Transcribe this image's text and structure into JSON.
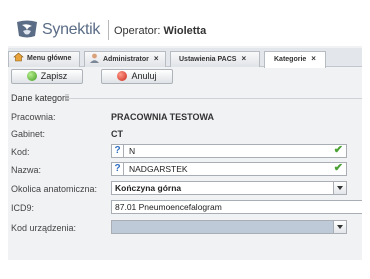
{
  "header": {
    "brand": "Synektik",
    "operator_label": "Operator:",
    "operator_name": "Wioletta"
  },
  "tabs": [
    {
      "label": "Menu główne",
      "icon": "home-icon",
      "closable": false
    },
    {
      "label": "Administrator",
      "icon": "user-icon",
      "closable": true
    },
    {
      "label": "Ustawienia PACS",
      "icon": "",
      "closable": true
    },
    {
      "label": "Kategorie",
      "icon": "",
      "closable": true,
      "active": true
    }
  ],
  "close_glyph": "×",
  "toolbar": {
    "save_label": "Zapisz",
    "cancel_label": "Anuluj"
  },
  "section": {
    "title": "Dane kategorii"
  },
  "form": {
    "pracownia": {
      "label": "Pracownia:",
      "value": "PRACOWNIA TESTOWA"
    },
    "gabinet": {
      "label": "Gabinet:",
      "value": "CT"
    },
    "kod": {
      "label": "Kod:",
      "value": "N",
      "help": "?",
      "valid": "✔"
    },
    "nazwa": {
      "label": "Nazwa:",
      "value": "NADGARSTEK",
      "help": "?",
      "valid": "✔"
    },
    "okolica": {
      "label": "Okolica anatomiczna:",
      "value": "Kończyna górna"
    },
    "icd9": {
      "label": "ICD9:",
      "value": "87.01 Pneumoencefalogram"
    },
    "kod_urzadzenia": {
      "label": "Kod urządzenia:",
      "value": ""
    }
  },
  "colors": {
    "accent_blue": "#2f6fc0",
    "valid_green": "#4aa133",
    "device_field_bg": "#bfcad8",
    "brand_gray": "#5a6c86"
  }
}
